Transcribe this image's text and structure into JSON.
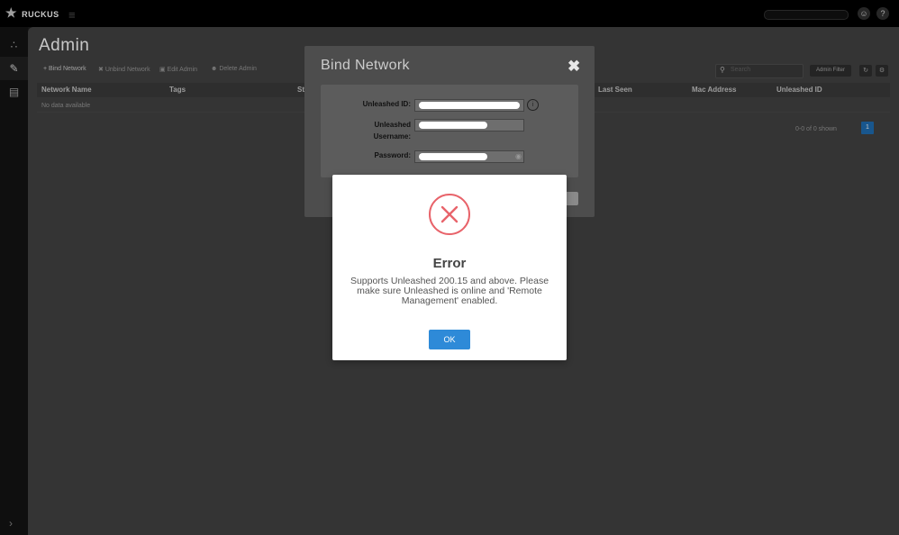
{
  "header": {
    "logo_text": "RUCKUS",
    "menu_icon": "hamburger-icon",
    "avatar_icon": "user-icon",
    "help_icon": "help-icon"
  },
  "sidebar": {
    "items": [
      {
        "icon": "network-icon"
      },
      {
        "icon": "admin-icon"
      },
      {
        "icon": "report-icon"
      }
    ],
    "expand_icon": "chevron-right-icon"
  },
  "page": {
    "title": "Admin",
    "toolbar": {
      "bind_network": "Bind Network",
      "unbind_network": "Unbind Network",
      "edit_admin": "Edit Admin",
      "delete_admin": "Delete Admin",
      "search_placeholder": "Search",
      "admin_filter": "Admin Filter"
    },
    "table": {
      "columns": [
        "Network Name",
        "Tags",
        "St",
        "Last Seen",
        "Mac Address",
        "Unleashed ID"
      ],
      "empty_text": "No data available"
    },
    "pagination": {
      "info": "0-0 of 0 shown",
      "current_page": "1"
    }
  },
  "bind_dialog": {
    "title": "Bind Network",
    "close_icon": "close-icon",
    "fields": {
      "unleashed_id_label": "Unleashed ID:",
      "username_label": "Unleashed Username:",
      "password_label": "Password:"
    }
  },
  "error_dialog": {
    "icon": "error-x-icon",
    "title": "Error",
    "message": "Supports Unleashed 200.15 and above. Please make sure Unleashed is online and 'Remote Management' enabled.",
    "ok_label": "OK"
  },
  "colors": {
    "error_red": "#e8636a",
    "primary_blue": "#2e8ad8",
    "page_bg": "#434343"
  }
}
